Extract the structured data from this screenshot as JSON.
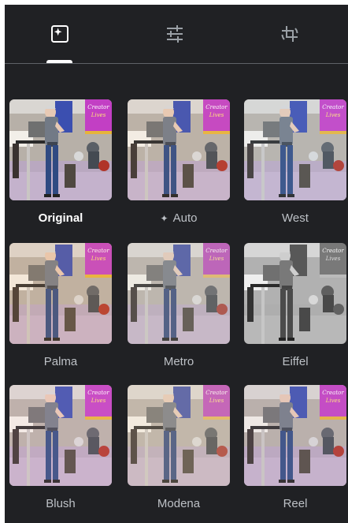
{
  "colors": {
    "panel_bg": "#202124",
    "tab_active": "#ffffff",
    "tab_inactive": "#9aa0a6",
    "divider": "#5f6368",
    "label": "#bdc1c6",
    "label_selected": "#ffffff"
  },
  "tabs": [
    {
      "icon": "auto-enhance-icon",
      "active": true
    },
    {
      "icon": "adjust-sliders-icon",
      "active": false
    },
    {
      "icon": "crop-rotate-icon",
      "active": false
    }
  ],
  "filters": [
    {
      "label": "Original",
      "selected": true,
      "auto_icon": false,
      "tint": "#ffffff",
      "tint_opacity": 0,
      "grayscale": 0
    },
    {
      "label": "Auto",
      "selected": false,
      "auto_icon": true,
      "tint": "#ffd0a0",
      "tint_opacity": 0.08,
      "grayscale": 0
    },
    {
      "label": "West",
      "selected": false,
      "auto_icon": false,
      "tint": "#c8e6ff",
      "tint_opacity": 0.1,
      "grayscale": 0
    },
    {
      "label": "Palma",
      "selected": false,
      "auto_icon": false,
      "tint": "#ffb870",
      "tint_opacity": 0.14,
      "grayscale": 0
    },
    {
      "label": "Metro",
      "selected": false,
      "auto_icon": false,
      "tint": "#e0d2c0",
      "tint_opacity": 0.18,
      "grayscale": 0.2
    },
    {
      "label": "Eiffel",
      "selected": false,
      "auto_icon": false,
      "tint": "#ffffff",
      "tint_opacity": 0,
      "grayscale": 1
    },
    {
      "label": "Blush",
      "selected": false,
      "auto_icon": false,
      "tint": "#ffc0d0",
      "tint_opacity": 0.12,
      "grayscale": 0
    },
    {
      "label": "Modena",
      "selected": false,
      "auto_icon": false,
      "tint": "#f4d8b0",
      "tint_opacity": 0.2,
      "grayscale": 0.15
    },
    {
      "label": "Reel",
      "selected": false,
      "auto_icon": false,
      "tint": "#d8b8d0",
      "tint_opacity": 0.12,
      "grayscale": 0
    }
  ],
  "banner_texts": {
    "left": "Creator",
    "right": "Lives"
  }
}
